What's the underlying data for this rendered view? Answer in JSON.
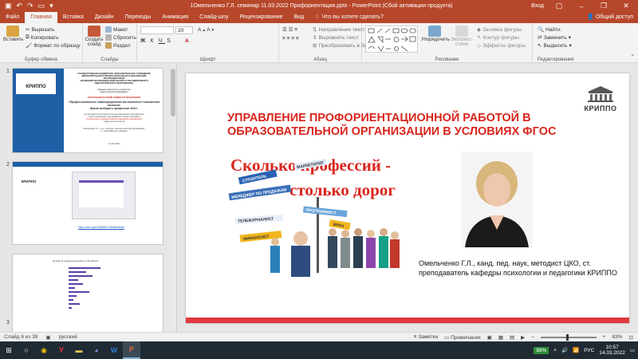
{
  "titlebar": {
    "title": "1Омельченко Г.Л. семинар 11.03.2022 Профориентация.pptx - PowerPoint (Сбой активации продукта)",
    "login": "Вход"
  },
  "tabs": [
    "Файл",
    "Главная",
    "Вставка",
    "Дизайн",
    "Переходы",
    "Анимация",
    "Слайд-шоу",
    "Рецензирование",
    "Вид"
  ],
  "active_tab": "Главная",
  "search_placeholder": "Что вы хотите сделать?",
  "share_label": "Общий доступ",
  "ribbon": {
    "clipboard": {
      "paste": "Вставить",
      "cut": "Вырезать",
      "copy": "Копировать",
      "format": "Формат по образцу",
      "label": "Буфер обмена"
    },
    "slides": {
      "create": "Создать слайд",
      "layout": "Макет",
      "reset": "Сбросить",
      "section": "Раздел",
      "label": "Слайды"
    },
    "font": {
      "size": "20",
      "label": "Шрифт"
    },
    "paragraph": {
      "direction": "Направление текста",
      "align": "Выровнять текст",
      "smartart": "Преобразовать в SmartArt",
      "label": "Абзац"
    },
    "drawing": {
      "arrange": "Упорядочить",
      "styles": "Экспресс-стили",
      "fill": "Заливка фигуры",
      "outline": "Контур фигуры",
      "effects": "Эффекты фигуры",
      "label": "Рисование"
    },
    "editing": {
      "find": "Найти",
      "replace": "Заменить",
      "select": "Выделить",
      "label": "Редактирование"
    }
  },
  "thumbnails": [
    {
      "num": "1",
      "lines": [
        "ГОСУДАРСТВЕННОЕ БЮДЖЕТНОЕ ОБРАЗОВАТЕЛЬНОЕ УЧРЕЖДЕНИЕ",
        "ДОПОЛНИТЕЛЬНОГО ПРОФЕССИОНАЛЬНОГО ОБРАЗОВАНИЯ",
        "РЕСПУБЛИКИ КРЫМ",
        "«КРЫМСКИЙ РЕСПУБЛИКАНСКИЙ ИНСТИТУТ ПОСТДИПЛОМНОГО",
        "ПЕДАГОГИЧЕСКОГО ОБРАЗОВАНИЯ»"
      ],
      "center_line_1": "Кафедра психологии и педагогики",
      "center_line_2": "Центр качества образования",
      "seminar": "РЕСПУБЛИКАНСКИЙ СЕМИНАР-ПРАКТИКУМ",
      "theme": "«Профессиональное самоопределение как компонент становления личности.",
      "theme_2": "Время выбирать профессию 2022»",
      "body_1": "для методистов (специалистов) муниципальных методических",
      "body_2": "служб, курирующих преподавание учебного предмета",
      "body_3": "«Технология», руководителей методических объединений,",
      "body_4": "педагогов-психологов",
      "author": "Омельченко Г.Л., к.п.н., методист Центра качества образования,",
      "author_2": "ст. преподаватель кафедры",
      "date": "11.03.2022",
      "logo": "КРИППО"
    },
    {
      "num": "2",
      "logo": "КРИППО",
      "link": "https://forms.gle/2xRBMUTNBHRwHbwh"
    },
    {
      "num": "3",
      "chart_title": "Нужна ли профориентация в 4-8 классе?"
    }
  ],
  "slide": {
    "title": "УПРАВЛЕНИЕ ПРОФОРИЕНТАЦИОННОЙ РАБОТОЙ В ОБРАЗОВАТЕЛЬНОЙ ОРГАНИЗАЦИИ В УСЛОВИЯХ ФГОС",
    "logo": "КРИППО",
    "image_text_1": "Сколько профессий -",
    "image_text_2": "столько дорог",
    "signs": [
      "СТРОИТЕЛЬ",
      "МАРКЕТОЛОГ",
      "МЕНЕДЖЕР ПО ПРОДАЖАМ",
      "ПРОГРАММИСТ",
      "ТЕЛЕЖУРНАЛИСТ",
      "ВРАЧ",
      "ФИНАНСИСТ"
    ],
    "caption": "Омельченко Г.Л., канд. пед. наук, методист ЦКО, ст. преподаватель кафедры психологии и педагогики КРИППО"
  },
  "status": {
    "slide_info": "Слайд 6 из 39",
    "language": "русский",
    "notes": "Заметки",
    "comments": "Примечания",
    "zoom": "83%"
  },
  "taskbar": {
    "battery": "98%",
    "lang": "РУС",
    "time": "10:57",
    "date": "14.03.2022"
  }
}
